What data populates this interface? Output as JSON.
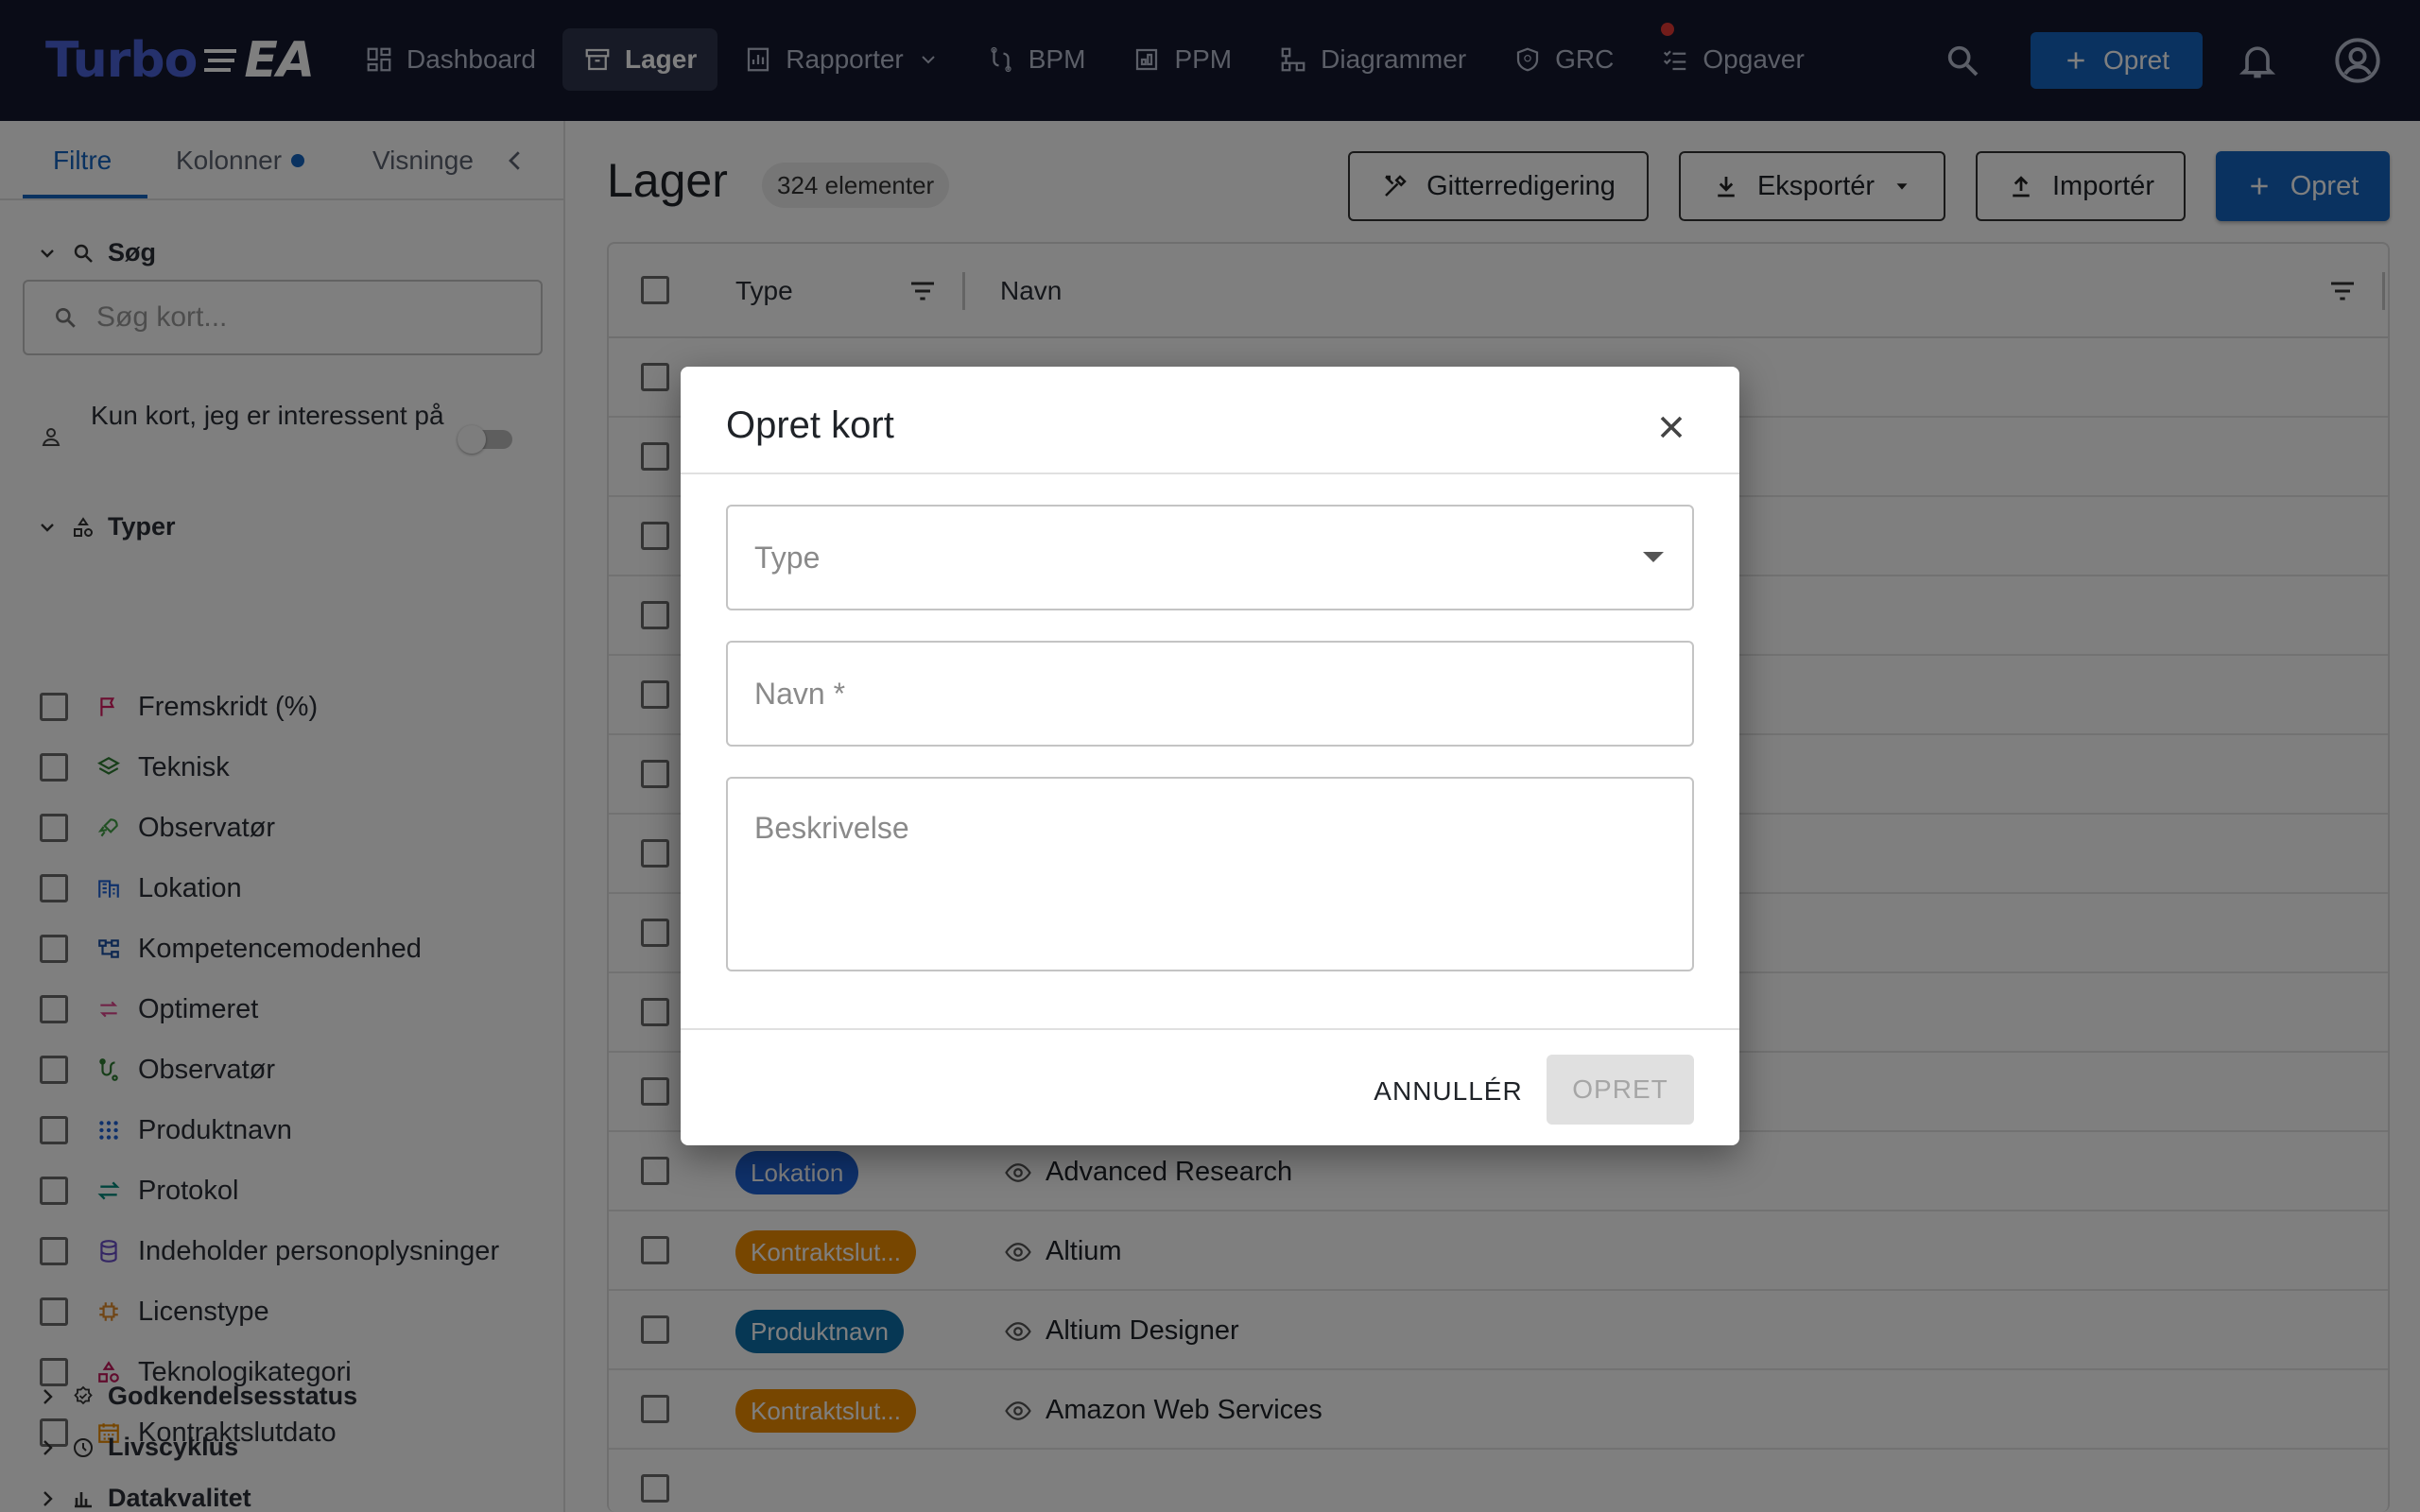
{
  "app": {
    "logo_part1": "Turbo",
    "logo_part2": "EA",
    "nav": [
      {
        "label": "Dashboard",
        "icon": "dashboard-icon"
      },
      {
        "label": "Lager",
        "icon": "archive-icon",
        "active": true
      },
      {
        "label": "Rapporter",
        "icon": "report-icon"
      },
      {
        "label": "BPM",
        "icon": "bpm-icon"
      },
      {
        "label": "PPM",
        "icon": "ppm-icon"
      },
      {
        "label": "Diagrammer",
        "icon": "diagram-icon"
      },
      {
        "label": "GRC",
        "icon": "shield-icon"
      },
      {
        "label": "Opgaver",
        "icon": "tasks-icon"
      }
    ],
    "create_label": "Opret",
    "colors": {
      "topbar": "#14182e",
      "accent": "#1565c0",
      "logo": "#4a63d9"
    }
  },
  "sidebar": {
    "tabs": [
      "Filtre",
      "Kolonner",
      "Visninge"
    ],
    "search_header": "Søg",
    "search_placeholder": "Søg kort...",
    "interest_label": "Kun kort, jeg er interessent på",
    "types_header": "Typer",
    "types": [
      {
        "label": "Fremskridt (%)",
        "icon": "flag-icon",
        "color": "#d81b60"
      },
      {
        "label": "Teknisk",
        "icon": "layers-icon",
        "color": "#2e7d32"
      },
      {
        "label": "Observatør",
        "icon": "rocket-icon",
        "color": "#43a047"
      },
      {
        "label": "Lokation",
        "icon": "building-icon",
        "color": "#1e63d6"
      },
      {
        "label": "Kompetencemodenhed",
        "icon": "hierarchy-icon",
        "color": "#1a4fa3"
      },
      {
        "label": "Optimeret",
        "icon": "arrows-icon",
        "color": "#e0478f"
      },
      {
        "label": "Observatør",
        "icon": "process-icon",
        "color": "#2e7d32"
      },
      {
        "label": "Produktnavn",
        "icon": "dots-grid-icon",
        "color": "#1e63d6"
      },
      {
        "label": "Protokol",
        "icon": "swap-icon",
        "color": "#00897b"
      },
      {
        "label": "Indeholder personoplysninger",
        "icon": "database-icon",
        "color": "#6a4fc9"
      },
      {
        "label": "Licenstype",
        "icon": "chip-icon",
        "color": "#e08a2b"
      },
      {
        "label": "Teknologikategori",
        "icon": "category-icon",
        "color": "#c2185b"
      },
      {
        "label": "Kontraktslutdato",
        "icon": "calendar-icon",
        "color": "#ef8c00"
      }
    ],
    "sections": [
      {
        "label": "Godkendelsesstatus",
        "icon": "approval-icon"
      },
      {
        "label": "Livscyklus",
        "icon": "clock-icon"
      },
      {
        "label": "Datakvalitet",
        "icon": "bar-chart-icon"
      }
    ]
  },
  "main": {
    "title": "Lager",
    "count": "324 elementer",
    "buttons": {
      "grid_edit": "Gitterredigering",
      "export": "Eksportér",
      "import": "Importér",
      "create": "Opret"
    },
    "columns": {
      "type": "Type",
      "name": "Navn"
    },
    "rows": [
      {
        "type": "Lokation",
        "type_color": "#1e63d6",
        "name": "Advanced Research"
      },
      {
        "type": "Kontraktslut...",
        "type_color": "#ef8c00",
        "name": "Altium"
      },
      {
        "type": "Produktnavn",
        "type_color": "#0d6ea8",
        "name": "Altium Designer"
      },
      {
        "type": "Kontraktslut...",
        "type_color": "#ef8c00",
        "name": "Amazon Web Services"
      }
    ]
  },
  "modal": {
    "title": "Opret kort",
    "type_label": "Type",
    "name_label": "Navn *",
    "description_label": "Beskrivelse",
    "cancel_label": "ANNULLÉR",
    "submit_label": "OPRET"
  }
}
